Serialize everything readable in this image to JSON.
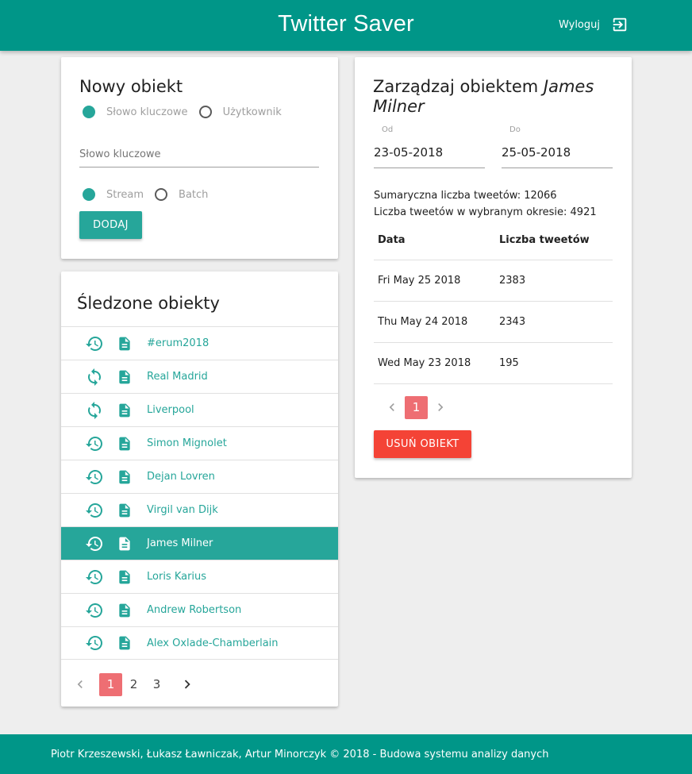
{
  "navbar": {
    "title": "Twitter Saver",
    "logout_label": "Wyloguj",
    "bg_color": "#009688"
  },
  "new_object": {
    "title": "Nowy obiekt",
    "type_options": [
      {
        "label": "Słowo kluczowe",
        "selected": true
      },
      {
        "label": "Użytkownik",
        "selected": false
      }
    ],
    "keyword_placeholder": "Słowo kluczowe",
    "mode_options": [
      {
        "label": "Stream",
        "selected": true
      },
      {
        "label": "Batch",
        "selected": false
      }
    ],
    "add_button": "DODAJ"
  },
  "tracked": {
    "title": "Śledzone obiekty",
    "items": [
      {
        "name": "#erum2018",
        "mode": "history-icon",
        "active": false
      },
      {
        "name": "Real Madrid",
        "mode": "sync-icon",
        "active": false
      },
      {
        "name": "Liverpool",
        "mode": "sync-icon",
        "active": false
      },
      {
        "name": "Simon Mignolet",
        "mode": "history-icon",
        "active": false
      },
      {
        "name": "Dejan Lovren",
        "mode": "history-icon",
        "active": false
      },
      {
        "name": "Virgil van Dijk",
        "mode": "history-icon",
        "active": false
      },
      {
        "name": "James Milner",
        "mode": "history-icon",
        "active": true
      },
      {
        "name": "Loris Karius",
        "mode": "history-icon",
        "active": false
      },
      {
        "name": "Andrew Robertson",
        "mode": "history-icon",
        "active": false
      },
      {
        "name": "Alex Oxlade-Chamberlain",
        "mode": "history-icon",
        "active": false
      }
    ],
    "pages": [
      "1",
      "2",
      "3"
    ],
    "current_page": "1"
  },
  "manage": {
    "title_prefix": "Zarządzaj obiektem ",
    "title_object": "James Milner",
    "from_label": "Od",
    "from_value": "23-05-2018",
    "to_label": "Do",
    "to_value": "25-05-2018",
    "total_tweets": "Sumaryczna liczba tweetów: 12066",
    "period_tweets": "Liczba tweetów w wybranym okresie: 4921",
    "table": {
      "headers": [
        "Data",
        "Liczba tweetów"
      ],
      "rows": [
        [
          "Fri May 25 2018",
          "2383"
        ],
        [
          "Thu May 24 2018",
          "2343"
        ],
        [
          "Wed May 23 2018",
          "195"
        ]
      ]
    },
    "pages": [
      "1"
    ],
    "current_page": "1",
    "delete_button": "USUŃ OBIEKT"
  },
  "footer": {
    "text": "Piotr Krzeszewski, Łukasz Ławniczak, Artur Minorczyk © 2018 - Budowa systemu analizy danych"
  },
  "colors": {
    "primary": "#009688",
    "teal": "#26a69a",
    "pager_active": "#ee6e73",
    "danger": "#f44336"
  }
}
